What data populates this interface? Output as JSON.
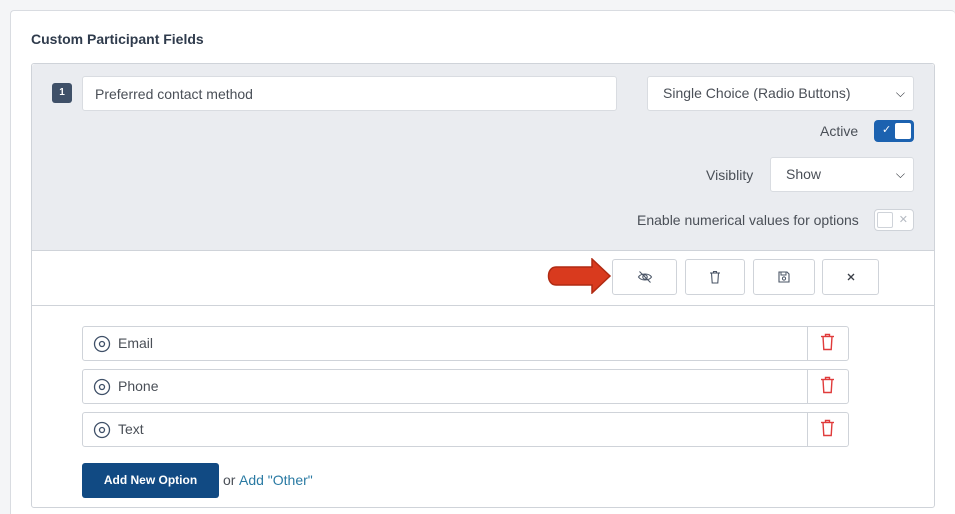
{
  "panel": {
    "title": "Custom Participant Fields"
  },
  "field": {
    "number": "1",
    "name_value": "Preferred contact method",
    "type_selected": "Single Choice (Radio Buttons)",
    "active_label": "Active",
    "active_on": true,
    "visibility_label": "Visiblity",
    "visibility_selected": "Show",
    "numerical_label": "Enable numerical values for options",
    "numerical_on": false
  },
  "toolbar": {
    "buttons": [
      {
        "icon": "eye-slash-icon"
      },
      {
        "icon": "trash-icon"
      },
      {
        "icon": "save-icon"
      },
      {
        "icon": "close-icon"
      }
    ]
  },
  "options": [
    {
      "label": "Email"
    },
    {
      "label": "Phone"
    },
    {
      "label": "Text"
    }
  ],
  "actions": {
    "add_option_label": "Add New Option",
    "or_text": "or",
    "add_other_label": "Add \"Other\""
  },
  "colors": {
    "primary": "#114a83",
    "toggle_on": "#1c62b0",
    "danger": "#e03b3b",
    "annotation_arrow": "#d93a1e",
    "link": "#2a7aa3"
  }
}
